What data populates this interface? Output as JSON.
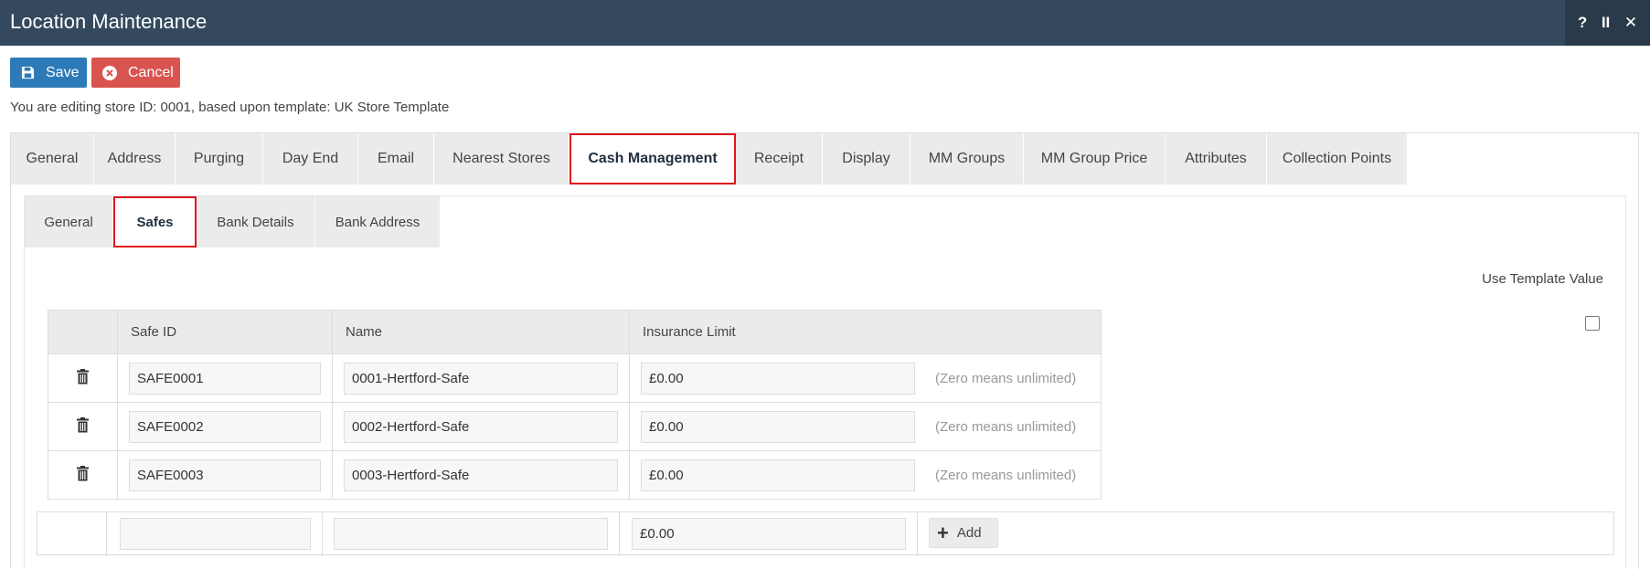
{
  "window": {
    "title": "Location Maintenance",
    "help_label": "?",
    "pause_label": "II",
    "close_label": "✕"
  },
  "toolbar": {
    "save_label": "Save",
    "cancel_label": "Cancel",
    "save_icon": "floppy-disk-icon",
    "cancel_icon": "x-circle-icon",
    "save_color": "#2e7ab8",
    "cancel_color": "#d9534f"
  },
  "editing_note": "You are editing store ID: 0001, based upon template: UK Store Template",
  "main_tabs": [
    {
      "label": "General"
    },
    {
      "label": "Address"
    },
    {
      "label": "Purging"
    },
    {
      "label": "Day End"
    },
    {
      "label": "Email"
    },
    {
      "label": "Nearest Stores"
    },
    {
      "label": "Cash Management",
      "active": true
    },
    {
      "label": "Receipt"
    },
    {
      "label": "Display"
    },
    {
      "label": "MM Groups"
    },
    {
      "label": "MM Group Price"
    },
    {
      "label": "Attributes"
    },
    {
      "label": "Collection Points"
    }
  ],
  "sub_tabs": [
    {
      "label": "General"
    },
    {
      "label": "Safes",
      "active": true
    },
    {
      "label": "Bank Details"
    },
    {
      "label": "Bank Address"
    }
  ],
  "use_template_label": "Use Template Value",
  "use_template_checked": false,
  "safes": {
    "columns": [
      "Safe ID",
      "Name",
      "Insurance Limit"
    ],
    "hint": "(Zero means unlimited)",
    "rows": [
      {
        "safe_id": "SAFE0001",
        "name": "0001-Hertford-Safe",
        "insurance_limit": "£0.00"
      },
      {
        "safe_id": "SAFE0002",
        "name": "0002-Hertford-Safe",
        "insurance_limit": "£0.00"
      },
      {
        "safe_id": "SAFE0003",
        "name": "0003-Hertford-Safe",
        "insurance_limit": "£0.00"
      }
    ],
    "new_row": {
      "safe_id": "",
      "name": "",
      "insurance_limit": "£0.00"
    },
    "add_label": "Add"
  },
  "colors": {
    "titlebar": "#34495e",
    "active_tab_border": "#e1141b"
  }
}
